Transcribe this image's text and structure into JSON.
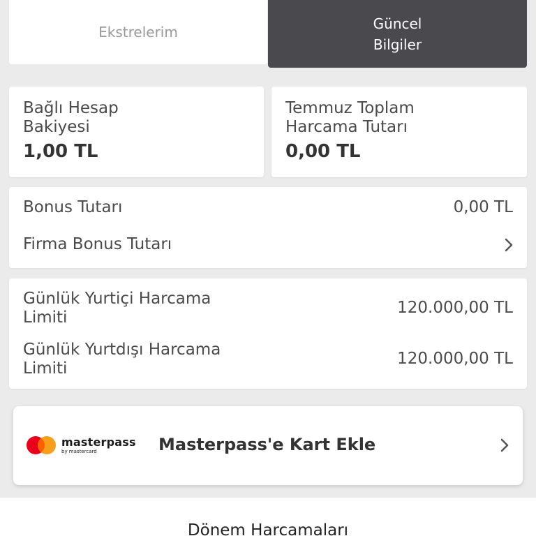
{
  "tabs": {
    "statements": "Ekstrelerim",
    "current_info": "Güncel\nBilgiler"
  },
  "balance": {
    "title": "Bağlı Hesap\nBakiyesi",
    "amount": "1,00 TL"
  },
  "monthly_total": {
    "title": "Temmuz Toplam\nHarcama Tutarı",
    "amount": "0,00 TL"
  },
  "bonus": {
    "label": "Bonus Tutarı",
    "value": "0,00 TL",
    "company_label": "Firma Bonus Tutarı"
  },
  "limits": {
    "domestic_label": "Günlük Yurtiçi Harcama\nLimiti",
    "domestic_value": "120.000,00 TL",
    "abroad_label": "Günlük Yurtdışı Harcama\nLimiti",
    "abroad_value": "120.000,00 TL"
  },
  "masterpass": {
    "brand": "masterpass",
    "by": "by mastercard",
    "title": "Masterpass'e Kart Ekle",
    "colors": {
      "red": "#eb001b",
      "orange": "#f79e1b"
    }
  },
  "bottom": {
    "title": "Dönem Harcamaları"
  },
  "colors": {
    "background": "#ebebeb",
    "active_tab": "#4a494e"
  }
}
